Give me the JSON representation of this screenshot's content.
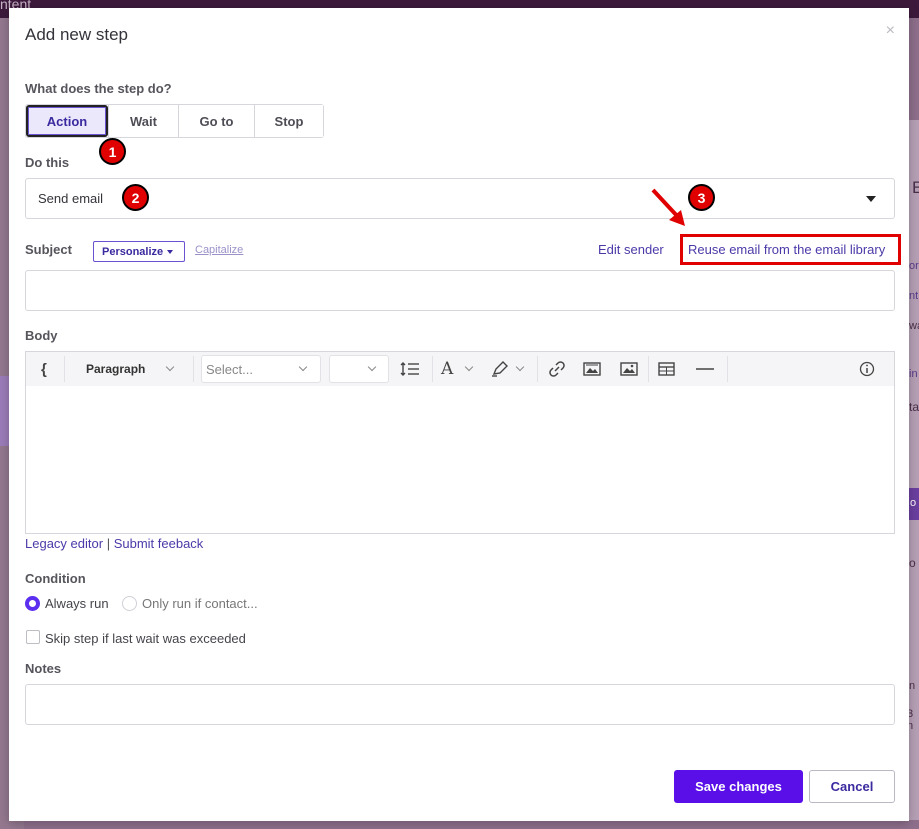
{
  "background": {
    "top_text": "ntent",
    "right_letters": [
      "E",
      "or",
      "nt",
      "wa",
      "in",
      "ta",
      "o",
      "o",
      "n",
      "3 n"
    ]
  },
  "modal": {
    "title": "Add new step",
    "close_label": "×",
    "step_type": {
      "label": "What does the step do?",
      "options": [
        "Action",
        "Wait",
        "Go to",
        "Stop"
      ],
      "selected": "Action"
    },
    "do_this": {
      "label": "Do this",
      "value": "Send email"
    },
    "subject": {
      "label": "Subject",
      "personalize_label": "Personalize",
      "capitalize_label": "Capitalize",
      "edit_sender_label": "Edit sender",
      "reuse_label": "Reuse email from the email library",
      "value": ""
    },
    "body": {
      "label": "Body",
      "toolbar": {
        "brace": "{",
        "paragraph": "Paragraph",
        "font_placeholder": "Select...",
        "text_color_glyph": "A"
      },
      "legacy_label": "Legacy editor",
      "link_separator": "|",
      "feedback_label": "Submit feeback"
    },
    "condition": {
      "label": "Condition",
      "options": [
        "Always run",
        "Only run if contact..."
      ],
      "selected": "Always run"
    },
    "skip_step_label": "Skip step if last wait was exceeded",
    "notes": {
      "label": "Notes",
      "value": ""
    },
    "save_label": "Save changes",
    "cancel_label": "Cancel"
  },
  "annotations": {
    "badges": [
      "1",
      "2",
      "3"
    ],
    "highlight_color": "#e00000"
  },
  "colors": {
    "accent": "#5a0fe8",
    "link": "#4a3aa8",
    "backdrop": "#8e6f8c"
  }
}
